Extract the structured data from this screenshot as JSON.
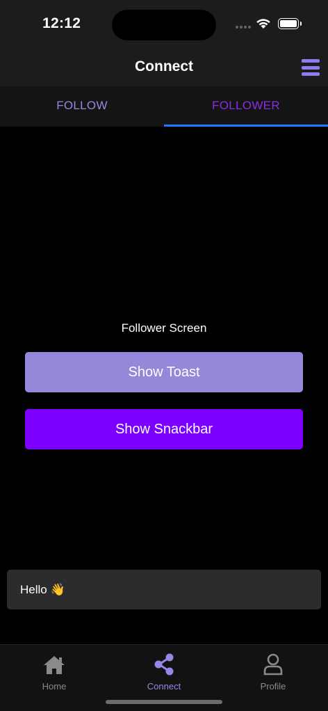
{
  "status_bar": {
    "time": "12:12"
  },
  "header": {
    "title": "Connect",
    "menu_icon": "hamburger-menu-icon"
  },
  "tabs": [
    {
      "label": "FOLLOW",
      "active": false
    },
    {
      "label": "FOLLOWER",
      "active": true
    }
  ],
  "content": {
    "screen_label": "Follower Screen",
    "toast_button": "Show Toast",
    "snackbar_button": "Show Snackbar"
  },
  "toast": {
    "message": "Hello 👋"
  },
  "bottom_nav": [
    {
      "label": "Home",
      "icon": "home-icon",
      "active": false
    },
    {
      "label": "Connect",
      "icon": "share-icon",
      "active": true
    },
    {
      "label": "Profile",
      "icon": "person-icon",
      "active": false
    }
  ],
  "colors": {
    "accent": "#9a86e8",
    "primary_button": "#7b00ff",
    "secondary_button": "#9488da",
    "tab_indicator": "#1f7aff",
    "active_tab_text": "#8a2ee6"
  }
}
